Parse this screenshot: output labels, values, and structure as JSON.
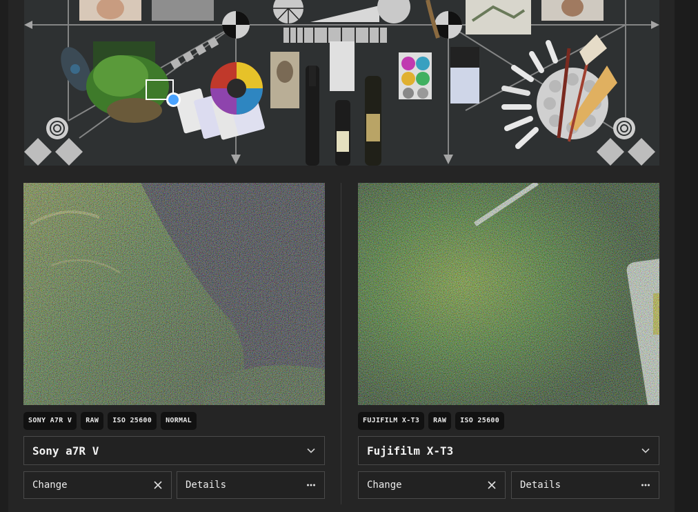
{
  "overview": {
    "selection_icon": "magnifier-selection-box",
    "scene_items": [
      "portrait-photo",
      "texture-swatch",
      "resolution-wheel",
      "gray-ramp",
      "feathers",
      "color-wheel",
      "playing-cards",
      "banknote",
      "wine-bottles",
      "ruler",
      "spiral-cards",
      "paints",
      "palette",
      "brushes",
      "siemens-stars"
    ]
  },
  "left": {
    "tags": [
      "SONY A7R V",
      "RAW",
      "ISO 25600",
      "NORMAL"
    ],
    "camera": "Sony a7R V",
    "change_label": "Change",
    "details_label": "Details",
    "change_icon": "close-icon",
    "details_icon": "more-horizontal-icon",
    "dropdown_icon": "chevron-down-icon"
  },
  "right": {
    "tags": [
      "FUJIFILM X-T3",
      "RAW",
      "ISO 25600"
    ],
    "camera": "Fujifilm X-T3",
    "change_label": "Change",
    "details_label": "Details",
    "change_icon": "close-icon",
    "details_icon": "more-horizontal-icon",
    "dropdown_icon": "chevron-down-icon"
  },
  "colors": {
    "background": "#1e1e1e",
    "panel": "#252525",
    "border": "#4a4a4a",
    "tag_bg": "#111111",
    "handle_accent": "#4aa3ff"
  }
}
